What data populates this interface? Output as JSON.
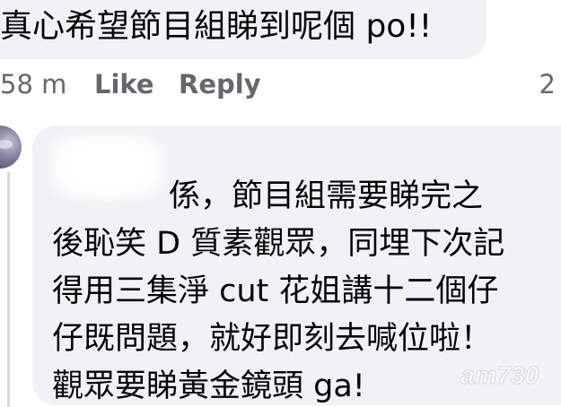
{
  "top_comment": {
    "text": "真心希望節目組睇到呢個 po!!"
  },
  "actions": {
    "time": "58 m",
    "like": "Like",
    "reply": "Reply",
    "count": "2"
  },
  "reply_comment": {
    "lines": [
      "係，節目組需要睇完之",
      "後恥笑 D 質素觀眾，同埋下次記",
      "得用三集淨 cut 花姐講十二個仔",
      "仔既問題，就好即刻去喊位啦！",
      "觀眾要睇黃金鏡頭 ga!"
    ]
  },
  "watermark": {
    "text": "am730"
  },
  "colors": {
    "bubble": "#f0f2f5",
    "text": "#050505",
    "secondary": "#65676b"
  }
}
